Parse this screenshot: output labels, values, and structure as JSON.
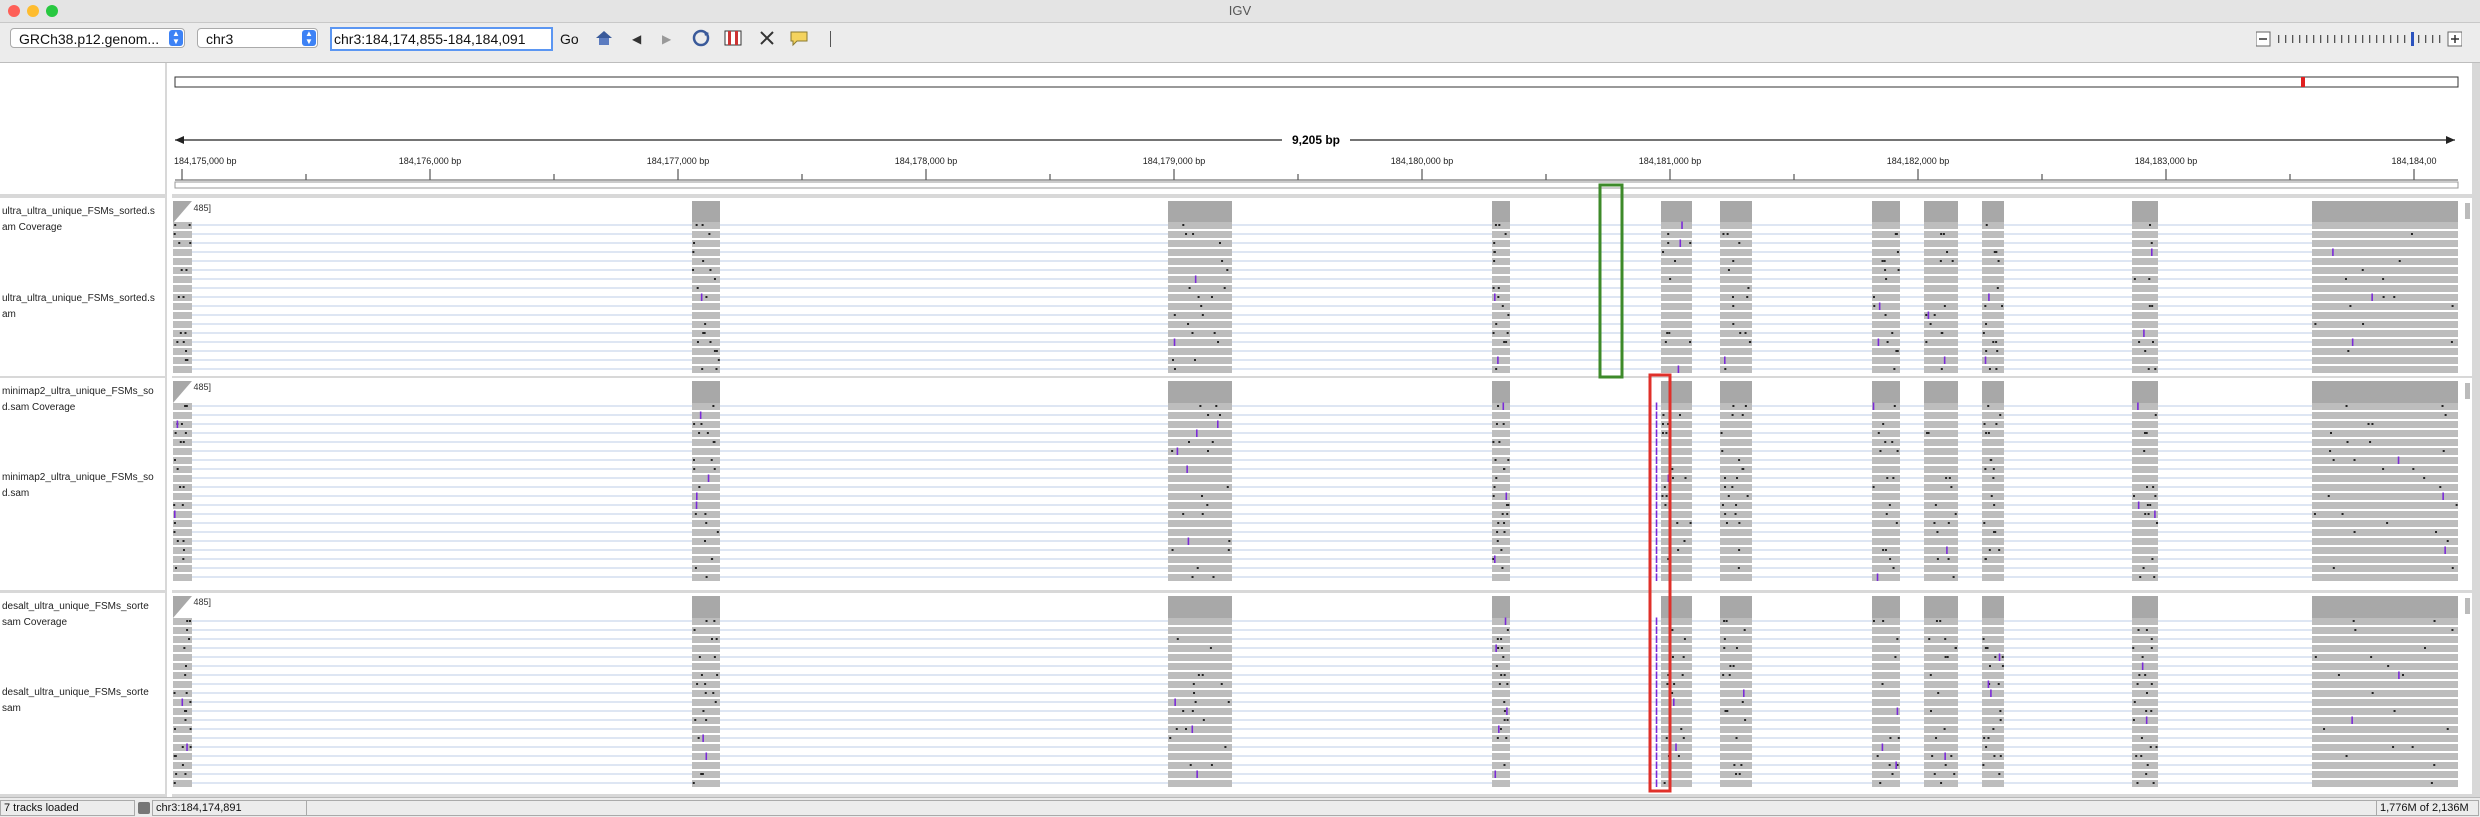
{
  "window": {
    "title": "IGV"
  },
  "toolbar": {
    "genome": "GRCh38.p12.genom...",
    "chromosome": "chr3",
    "locus": "chr3:184,174,855-184,184,091",
    "go_label": "Go"
  },
  "ruler": {
    "span_label": "9,205 bp",
    "ticks": [
      "184,175,000 bp",
      "184,176,000 bp",
      "184,177,000 bp",
      "184,178,000 bp",
      "184,179,000 bp",
      "184,180,000 bp",
      "184,181,000 bp",
      "184,182,000 bp",
      "184,183,000 bp",
      "184,184,00"
    ]
  },
  "tracks": [
    {
      "coverage_name": "ultra_ultra_unique_FSMs_sorted.sam Coverage",
      "coverage_line1": "ultra_ultra_unique_FSMs_sorted.s",
      "coverage_line2": "am Coverage",
      "range": "[0 - 485]",
      "align_line1": "ultra_ultra_unique_FSMs_sorted.s",
      "align_line2": "am"
    },
    {
      "coverage_line1": "minimap2_ultra_unique_FSMs_so",
      "coverage_line2": "d.sam Coverage",
      "range": "[0 - 485]",
      "align_line1": "minimap2_ultra_unique_FSMs_so",
      "align_line2": "d.sam"
    },
    {
      "coverage_line1": "desalt_ultra_unique_FSMs_sorte",
      "coverage_line2": "sam Coverage",
      "range": "[0 - 485]",
      "align_line1": "desalt_ultra_unique_FSMs_sorte",
      "align_line2": "sam"
    }
  ],
  "highlights": {
    "green_color": "#3d8a2a",
    "red_color": "#e0302a"
  },
  "status": {
    "tracks_loaded": "7 tracks loaded",
    "position": "chr3:184,174,891",
    "memory": "1,776M of 2,136M"
  }
}
